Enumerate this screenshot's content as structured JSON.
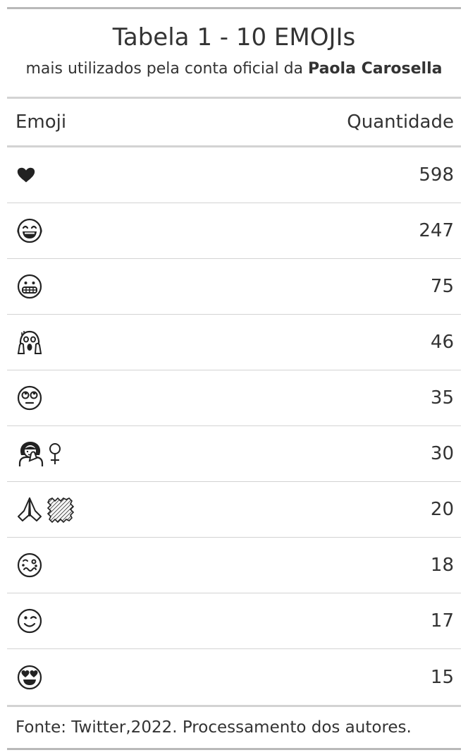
{
  "table": {
    "title": "Tabela 1 - 10 EMOJIs",
    "subtitle_prefix": "mais utilizados pela conta oficial da ",
    "subtitle_bold": "Paola Carosella",
    "columns": [
      "Emoji",
      "Quantidade"
    ],
    "rows": [
      {
        "emoji_icon": "heart-icon",
        "emoji": "❤",
        "count": "598"
      },
      {
        "emoji_icon": "face-tears-of-joy-icon",
        "emoji": "😂",
        "count": "247"
      },
      {
        "emoji_icon": "grimacing-face-icon",
        "emoji": "😬",
        "count": "75"
      },
      {
        "emoji_icon": "face-screaming-in-fear-icon",
        "emoji": "😱",
        "count": "46"
      },
      {
        "emoji_icon": "face-rolling-eyes-icon",
        "emoji": "🙄",
        "count": "35"
      },
      {
        "emoji_icon": "woman-facepalming-icon",
        "emoji": "🤦‍♀",
        "count": "30"
      },
      {
        "emoji_icon": "folded-hands-skin-tone-icon",
        "emoji": "🙏🏼",
        "count": "20"
      },
      {
        "emoji_icon": "woozy-face-icon",
        "emoji": "🥴",
        "count": "18"
      },
      {
        "emoji_icon": "winking-face-icon",
        "emoji": "😉",
        "count": "17"
      },
      {
        "emoji_icon": "smiling-face-heart-eyes-icon",
        "emoji": "😍",
        "count": "15"
      }
    ],
    "footer": "Fonte: Twitter,2022. Processamento dos autores."
  }
}
